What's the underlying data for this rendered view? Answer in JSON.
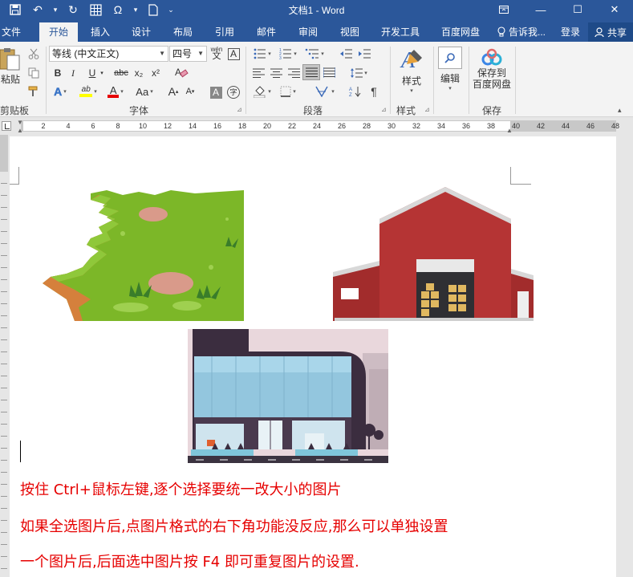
{
  "app": {
    "title": "文档1 - Word"
  },
  "quick_access": {
    "icons": [
      "save-icon",
      "undo-icon",
      "redo-icon",
      "table-icon",
      "omega-icon",
      "new-doc-icon",
      "customize-icon"
    ],
    "undo_glyph": "↶",
    "redo_glyph": "↻",
    "omega_glyph": "Ω"
  },
  "window_controls": {
    "restore": "▭",
    "minimize": "—",
    "maximize": "☐",
    "close": "✕"
  },
  "tabs": [
    {
      "label": "文件"
    },
    {
      "label": "开始",
      "active": true
    },
    {
      "label": "插入"
    },
    {
      "label": "设计"
    },
    {
      "label": "布局"
    },
    {
      "label": "引用"
    },
    {
      "label": "邮件"
    },
    {
      "label": "审阅"
    },
    {
      "label": "视图"
    },
    {
      "label": "开发工具"
    },
    {
      "label": "百度网盘"
    }
  ],
  "header_right": {
    "tell_me": "告诉我...",
    "login": "登录",
    "share": "共享"
  },
  "ribbon": {
    "clipboard": {
      "paste_label": "粘贴",
      "group_label": "剪贴板"
    },
    "font": {
      "font_name": "等线 (中文正文)",
      "font_size": "四号",
      "wen_glyph": "wén",
      "phonetic_char": "文",
      "border_a": "A",
      "bold": "B",
      "italic": "I",
      "underline": "U",
      "strike": "abc",
      "subscript": "x₂",
      "superscript": "x²",
      "effects_a": "A",
      "highlight_a": "ab",
      "color_a": "A",
      "case_aa": "Aa",
      "grow_a": "A",
      "shrink_a": "A",
      "shade_a": "A",
      "circle_char": "字",
      "group_label": "字体",
      "highlight_color": "#ffff00",
      "font_color": "#e60000"
    },
    "paragraph": {
      "group_label": "段落"
    },
    "styles": {
      "label": "样式",
      "group_label": "样式"
    },
    "editing": {
      "label": "编辑"
    },
    "save": {
      "label_line1": "保存到",
      "label_line2": "百度网盘",
      "group_label": "保存"
    }
  },
  "ruler": {
    "ticks": [
      "2",
      "4",
      "6",
      "8",
      "10",
      "12",
      "14",
      "16",
      "18",
      "20",
      "22",
      "24",
      "26",
      "28",
      "30",
      "32",
      "34",
      "36",
      "38",
      "40",
      "42",
      "44",
      "46",
      "48"
    ]
  },
  "document": {
    "lines": [
      "按住 Ctrl+鼠标左键,逐个选择要统一改大小的图片",
      "如果全选图片后,点图片格式的右下角功能没反应,那么可以单独设置",
      "一个图片后,后面选中图片按 F4 即可重复图片的设置."
    ],
    "text_color": "#e60000"
  },
  "colors": {
    "accent": "#2b579a",
    "ribbon_bg": "#f3f3f3"
  }
}
